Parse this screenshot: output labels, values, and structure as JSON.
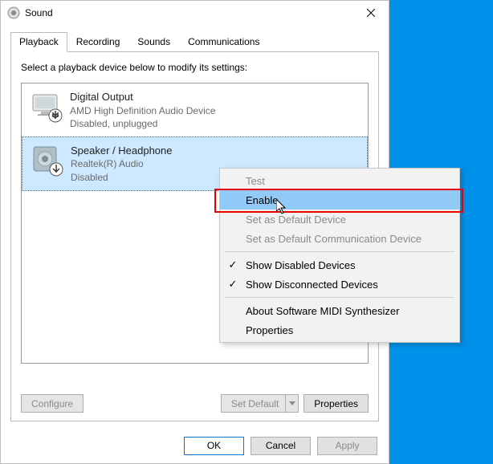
{
  "window": {
    "title": "Sound",
    "close_aria": "Close"
  },
  "tabs": {
    "playback": "Playback",
    "recording": "Recording",
    "sounds": "Sounds",
    "communications": "Communications"
  },
  "playback_panel": {
    "instruction": "Select a playback device below to modify its settings:",
    "devices": [
      {
        "name": "Digital Output",
        "driver": "AMD High Definition Audio Device",
        "status": "Disabled, unplugged"
      },
      {
        "name": "Speaker / Headphone",
        "driver": "Realtek(R) Audio",
        "status": "Disabled"
      }
    ],
    "configure_btn": "Configure",
    "set_default_btn": "Set Default",
    "properties_btn": "Properties"
  },
  "footer": {
    "ok": "OK",
    "cancel": "Cancel",
    "apply": "Apply"
  },
  "context_menu": {
    "test": "Test",
    "enable": "Enable",
    "set_default": "Set as Default Device",
    "set_default_comm": "Set as Default Communication Device",
    "show_disabled": "Show Disabled Devices",
    "show_disconnected": "Show Disconnected Devices",
    "about_midi": "About Software MIDI Synthesizer",
    "properties": "Properties"
  }
}
